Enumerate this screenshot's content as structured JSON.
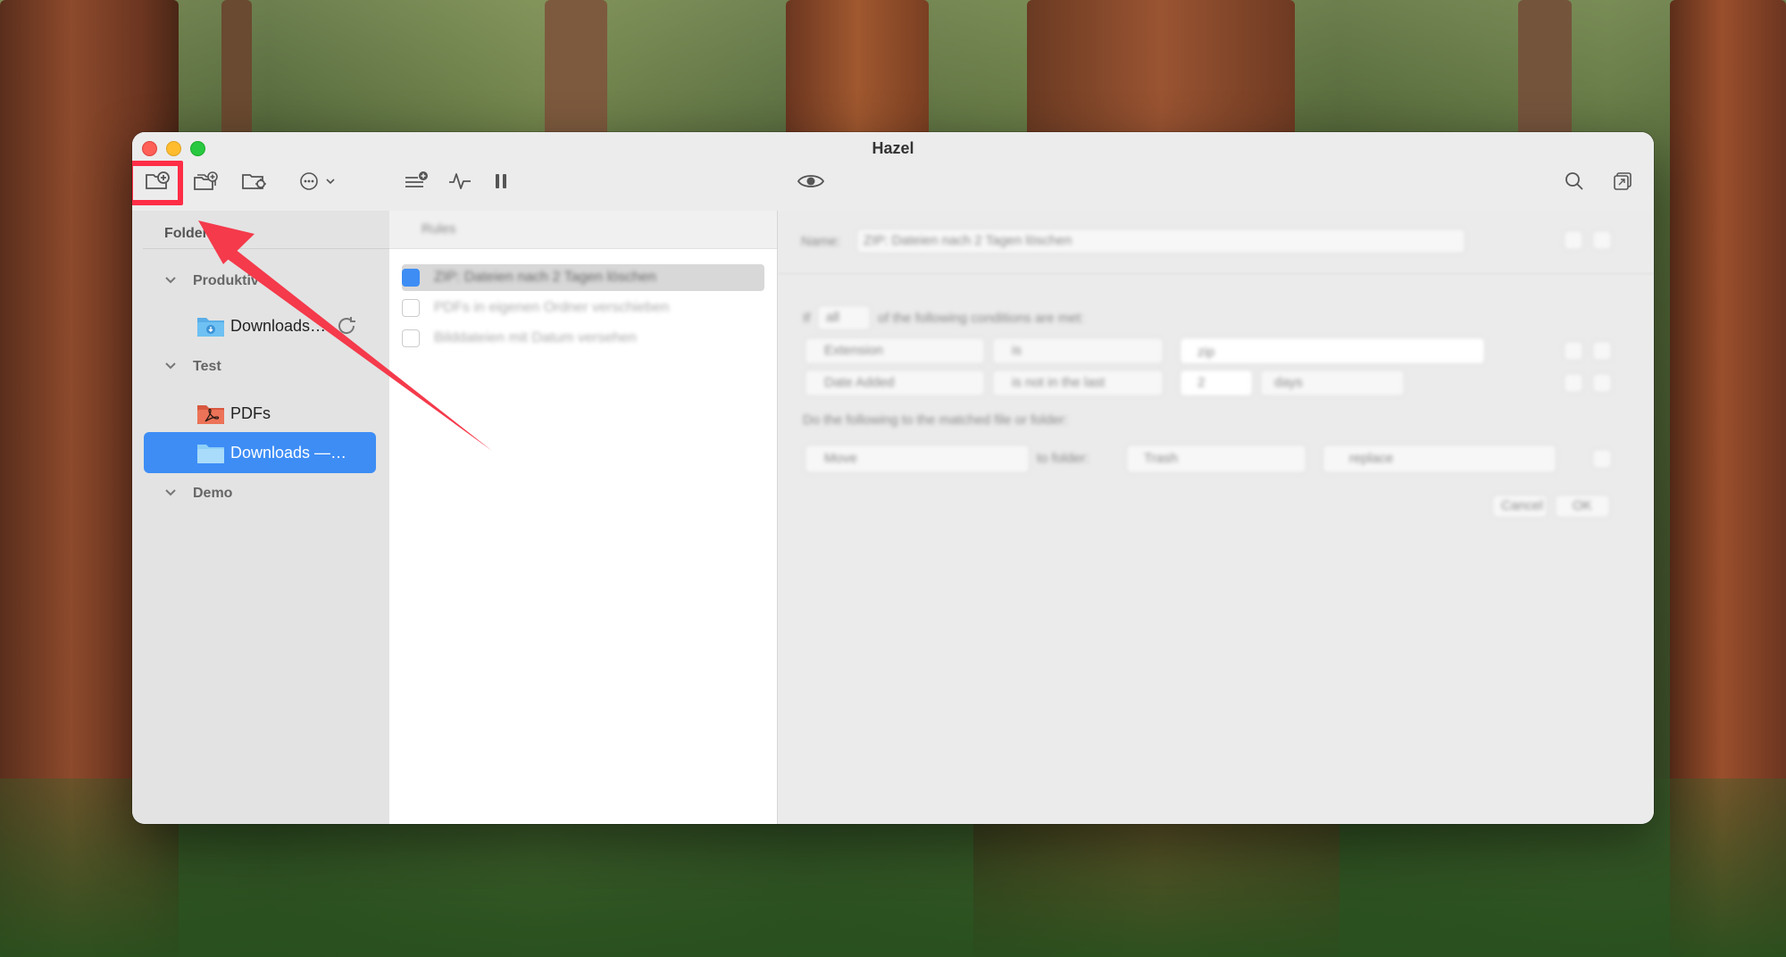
{
  "window": {
    "title": "Hazel"
  },
  "toolbar": {
    "buttons": [
      {
        "icon": "add-folder-icon"
      },
      {
        "icon": "duplicate-folder-icon"
      },
      {
        "icon": "folder-settings-icon"
      },
      {
        "icon": "more-options-icon"
      },
      {
        "icon": "add-rule-icon"
      },
      {
        "icon": "activity-icon"
      },
      {
        "icon": "pause-icon"
      },
      {
        "icon": "preview-icon"
      },
      {
        "icon": "search-icon"
      },
      {
        "icon": "window-icon"
      }
    ]
  },
  "sidebar": {
    "header": "Folders",
    "groups": [
      {
        "label": "Produktiv",
        "items": [
          {
            "label": "Downloads…",
            "icon": "downloads-folder-icon",
            "status": "sync-icon"
          }
        ]
      },
      {
        "label": "Test",
        "items": [
          {
            "label": "PDFs",
            "icon": "pdf-folder-icon"
          },
          {
            "label": "Downloads —…",
            "icon": "folder-icon",
            "selected": true
          }
        ]
      },
      {
        "label": "Demo",
        "items": []
      }
    ]
  },
  "rules": {
    "header": "Rules",
    "items": [
      {
        "label": "ZIP: Dateien nach 2 Tagen löschen",
        "enabled": true,
        "selected": true
      },
      {
        "label": "PDFs in eigenen Ordner verschieben",
        "enabled": false
      },
      {
        "label": "Bilddateien mit Datum versehen",
        "enabled": false
      }
    ]
  },
  "detail": {
    "name_label": "Name:",
    "name_value": "ZIP: Dateien nach 2 Tagen löschen",
    "if_text": "If",
    "if_select": "all",
    "conditions_text": "of the following conditions are met:",
    "conditions": [
      {
        "attribute": "Extension",
        "operator": "is",
        "value": "zip"
      },
      {
        "attribute": "Date Added",
        "operator": "is not in the last",
        "value": "2",
        "unit": "days"
      }
    ],
    "actions_text": "Do the following to the matched file or folder:",
    "actions": [
      {
        "action": "Move",
        "prep": "to folder:",
        "target": "Trash",
        "option": "replace"
      }
    ],
    "buttons": [
      "Cancel",
      "OK"
    ]
  },
  "colors": {
    "accent": "#3d8df5",
    "highlight": "#ff2d46",
    "arrow": "#f43a4b"
  }
}
